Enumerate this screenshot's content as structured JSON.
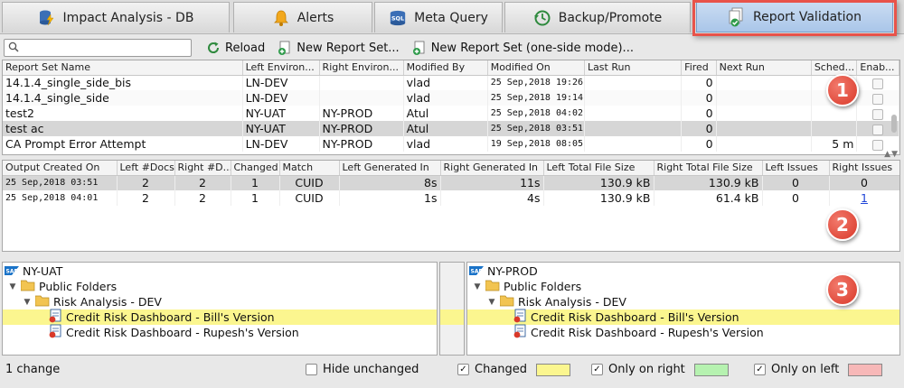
{
  "tabs": [
    {
      "label": "Impact Analysis - DB",
      "icon": "database-bolt-icon"
    },
    {
      "label": "Alerts",
      "icon": "bell-icon"
    },
    {
      "label": "Meta Query",
      "icon": "sql-database-icon"
    },
    {
      "label": "Backup/Promote",
      "icon": "history-clock-icon"
    },
    {
      "label": "Report Validation",
      "icon": "document-check-icon"
    }
  ],
  "toolbar": {
    "search_placeholder": "",
    "reload": "Reload",
    "new_report_set": "New Report Set...",
    "new_report_set_one_side": "New Report Set (one-side mode)..."
  },
  "report_sets": {
    "columns": [
      "Report Set Name",
      "Left Environ...",
      "Right Environ...",
      "Modified By",
      "Modified On",
      "Last Run",
      "Fired",
      "Next Run",
      "Sched...",
      "Enab..."
    ],
    "rows": [
      {
        "name": "14.1.4_single_side_bis",
        "left": "LN-DEV",
        "right": "",
        "by": "vlad",
        "on": "25 Sep,2018 19:26",
        "last": "",
        "fired": "0",
        "next": "",
        "sched": ""
      },
      {
        "name": "14.1.4_single_side",
        "left": "LN-DEV",
        "right": "",
        "by": "vlad",
        "on": "25 Sep,2018 19:14",
        "last": "",
        "fired": "0",
        "next": "",
        "sched": ""
      },
      {
        "name": "test2",
        "left": "NY-UAT",
        "right": "NY-PROD",
        "by": "Atul",
        "on": "25 Sep,2018 04:02",
        "last": "",
        "fired": "0",
        "next": "",
        "sched": ""
      },
      {
        "name": "test ac",
        "left": "NY-UAT",
        "right": "NY-PROD",
        "by": "Atul",
        "on": "25 Sep,2018 03:51",
        "last": "",
        "fired": "0",
        "next": "",
        "sched": ""
      },
      {
        "name": "CA Prompt Error Attempt",
        "left": "LN-DEV",
        "right": "NY-PROD",
        "by": "vlad",
        "on": "19 Sep,2018 08:05",
        "last": "",
        "fired": "0",
        "next": "",
        "sched": "5 m"
      }
    ]
  },
  "outputs": {
    "columns": [
      "Output Created On",
      "Left #Docs",
      "Right #D...",
      "Changed",
      "Match",
      "Left Generated In",
      "Right Generated In",
      "Left Total File Size",
      "Right Total File Size",
      "Left Issues",
      "Right Issues"
    ],
    "rows": [
      {
        "created": "25 Sep,2018 03:51",
        "ldocs": "2",
        "rdocs": "2",
        "changed": "1",
        "match": "CUID",
        "lgen": "8s",
        "rgen": "11s",
        "lsize": "130.9 kB",
        "rsize": "130.9 kB",
        "lissues": "0",
        "rissues": "0"
      },
      {
        "created": "25 Sep,2018 04:01",
        "ldocs": "2",
        "rdocs": "2",
        "changed": "1",
        "match": "CUID",
        "lgen": "1s",
        "rgen": "4s",
        "lsize": "130.9 kB",
        "rsize": "61.4 kB",
        "lissues": "0",
        "rissues": "1"
      }
    ]
  },
  "left_tree": {
    "root": "NY-UAT",
    "folder": "Public Folders",
    "subfolder": "Risk Analysis - DEV",
    "items": [
      "Credit Risk Dashboard - Bill's Version",
      "Credit Risk Dashboard - Rupesh's Version"
    ]
  },
  "right_tree": {
    "root": "NY-PROD",
    "folder": "Public Folders",
    "subfolder": "Risk Analysis - DEV",
    "items": [
      "Credit Risk Dashboard - Bill's Version",
      "Credit Risk Dashboard - Rupesh's Version"
    ]
  },
  "badges": [
    "1",
    "2",
    "3"
  ],
  "status": {
    "count": "1 change",
    "hide_unchanged": "Hide unchanged",
    "changed": "Changed",
    "only_right": "Only on right",
    "only_left": "Only on left",
    "check_mark": "✓"
  },
  "colors": {
    "changed": "#fbf68f",
    "only_right": "#b6f2b0",
    "only_left": "#f7b8b8",
    "highlight_border": "#e8534a"
  }
}
